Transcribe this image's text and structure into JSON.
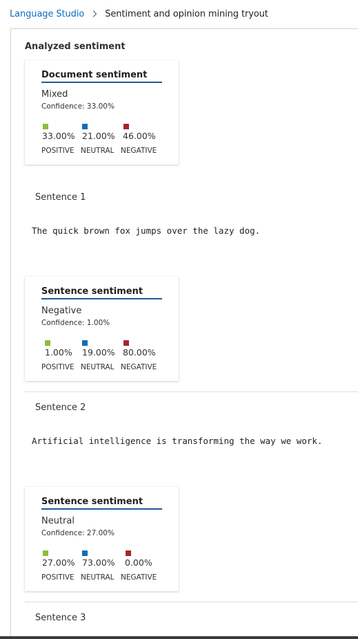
{
  "breadcrumb": {
    "root": "Language Studio",
    "current": "Sentiment and opinion mining tryout"
  },
  "section_title": "Analyzed sentiment",
  "colors": {
    "positive": "#8cbd3d",
    "neutral": "#0f6cbd",
    "negative": "#a4262c",
    "accent": "#1f5a94"
  },
  "categories": {
    "positive": "POSITIVE",
    "neutral": "NEUTRAL",
    "negative": "NEGATIVE"
  },
  "document": {
    "title": "Document sentiment",
    "label": "Mixed",
    "confidence": "Confidence: 33.00%",
    "positive": "33.00%",
    "neutral": "21.00%",
    "negative": "46.00%"
  },
  "sentences": [
    {
      "heading": "Sentence 1",
      "text": "The quick brown fox jumps over the lazy dog.",
      "card": {
        "title": "Sentence sentiment",
        "label": "Negative",
        "confidence": "Confidence: 1.00%",
        "positive": "1.00%",
        "neutral": "19.00%",
        "negative": "80.00%"
      }
    },
    {
      "heading": "Sentence 2",
      "text": "Artificial intelligence is transforming the way we work.",
      "card": {
        "title": "Sentence sentiment",
        "label": "Neutral",
        "confidence": "Confidence: 27.00%",
        "positive": "27.00%",
        "neutral": "73.00%",
        "negative": "0.00%"
      }
    },
    {
      "heading": "Sentence 3"
    }
  ]
}
